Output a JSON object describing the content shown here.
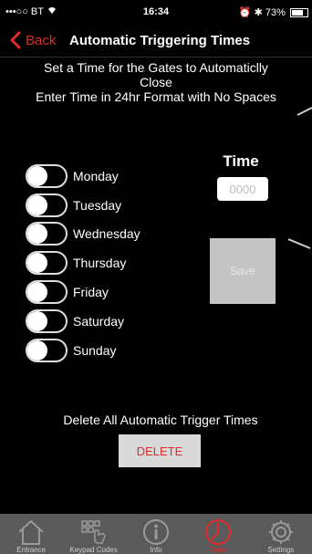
{
  "status": {
    "carrier": "•••○○ BT",
    "time": "16:34",
    "battery": "73%"
  },
  "nav": {
    "back_label": "Back",
    "title": "Automatic Triggering Times"
  },
  "instructions": {
    "line1": "Set a Time for the Gates to Automaticlly",
    "line2": "Close",
    "line3": "Enter Time in 24hr Format with No Spaces"
  },
  "days": [
    {
      "label": "Monday",
      "on": false
    },
    {
      "label": "Tuesday",
      "on": false
    },
    {
      "label": "Wednesday",
      "on": false
    },
    {
      "label": "Thursday",
      "on": false
    },
    {
      "label": "Friday",
      "on": false
    },
    {
      "label": "Saturday",
      "on": false
    },
    {
      "label": "Sunday",
      "on": false
    }
  ],
  "time": {
    "label": "Time",
    "placeholder": "0000",
    "value": ""
  },
  "save_label": "Save",
  "delete": {
    "prompt": "Delete All Automatic Trigger Times",
    "button_label": "DELETE"
  },
  "tabs": [
    {
      "label": "Entrance",
      "icon": "house-icon",
      "active": false
    },
    {
      "label": "Keypad Codes",
      "icon": "keypad-icon",
      "active": false
    },
    {
      "label": "Info",
      "icon": "info-icon",
      "active": false
    },
    {
      "label": "Times",
      "icon": "clock-icon",
      "active": true
    },
    {
      "label": "Settings",
      "icon": "gear-icon",
      "active": false
    }
  ],
  "colors": {
    "accent": "#e02b2b",
    "background": "#000000",
    "tab_bar": "#5a5a5a"
  }
}
